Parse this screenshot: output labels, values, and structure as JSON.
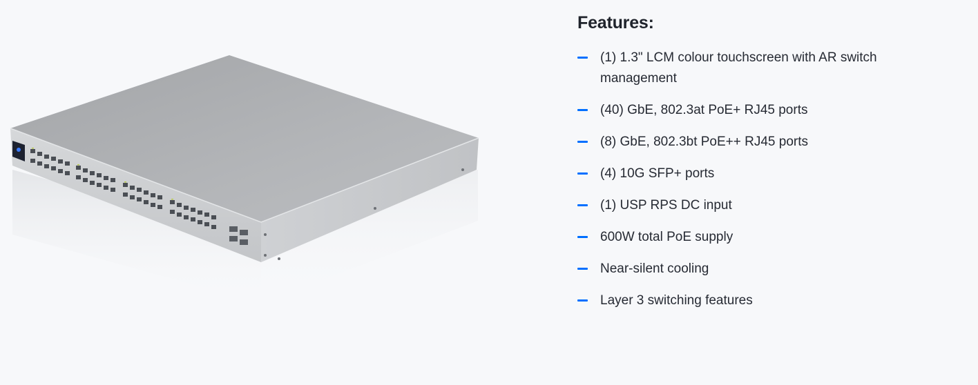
{
  "product": {
    "image_icon": "network-switch-image"
  },
  "features": {
    "title": "Features:",
    "items": [
      {
        "label": "(1) 1.3\" LCM colour touchscreen with AR switch management"
      },
      {
        "label": "(40) GbE, 802.3at PoE+ RJ45 ports"
      },
      {
        "label": "(8) GbE, 802.3bt PoE++ RJ45 ports"
      },
      {
        "label": "(4) 10G SFP+ ports"
      },
      {
        "label": "(1) USP RPS DC input"
      },
      {
        "label": "600W total PoE supply"
      },
      {
        "label": "Near-silent cooling"
      },
      {
        "label": "Layer 3 switching features"
      }
    ]
  },
  "colors": {
    "accent": "#006fff",
    "background": "#f7f8fa",
    "text": "#262a33"
  }
}
